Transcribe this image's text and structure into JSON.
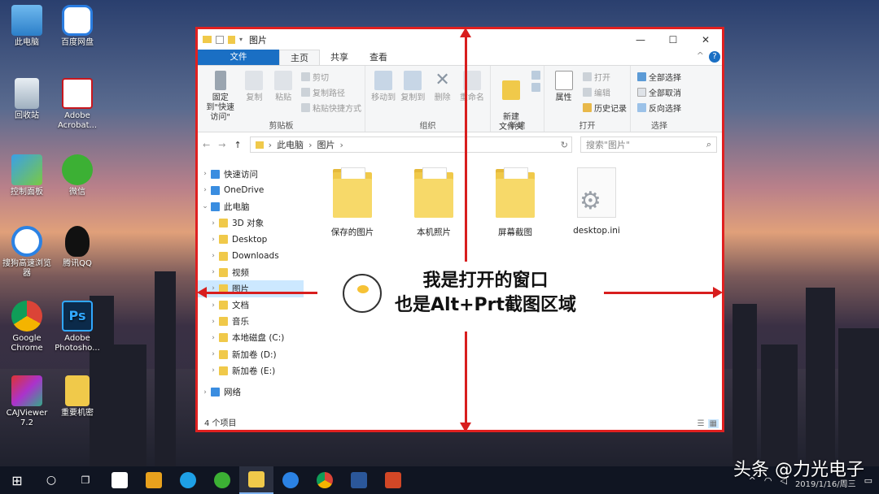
{
  "desktop": {
    "icons": [
      {
        "label": "此电脑",
        "icon": "computer-icon"
      },
      {
        "label": "百度网盘",
        "icon": "baidu-netdisk-icon"
      },
      {
        "label": "回收站",
        "icon": "recycle-bin-icon"
      },
      {
        "label": "Adobe Acrobat...",
        "icon": "acrobat-icon"
      },
      {
        "label": "控制面板",
        "icon": "control-panel-icon"
      },
      {
        "label": "微信",
        "icon": "wechat-icon"
      },
      {
        "label": "搜狗高速浏览器",
        "icon": "sogou-browser-icon"
      },
      {
        "label": "腾讯QQ",
        "icon": "qq-icon"
      },
      {
        "label": "Google Chrome",
        "icon": "chrome-icon"
      },
      {
        "label": "Adobe Photosho...",
        "icon": "photoshop-icon"
      },
      {
        "label": "CAJViewer 7.2",
        "icon": "cajviewer-icon"
      },
      {
        "label": "重要机密",
        "icon": "folder-icon"
      }
    ]
  },
  "window": {
    "title": "图片",
    "controls": {
      "minimize": "—",
      "maximize": "☐",
      "close": "✕"
    },
    "tabs": [
      {
        "label": "文件"
      },
      {
        "label": "主页"
      },
      {
        "label": "共享"
      },
      {
        "label": "查看"
      }
    ],
    "help": "?",
    "collapse": "^",
    "ribbon": {
      "clipboard": {
        "name": "剪贴板",
        "pin": "固定到\"快速访问\"",
        "copy": "复制",
        "paste": "粘贴",
        "cut": "剪切",
        "copy_path": "复制路径",
        "paste_shortcut": "粘贴快捷方式"
      },
      "organize": {
        "name": "组织",
        "move_to": "移动到",
        "copy_to": "复制到",
        "delete": "删除",
        "rename": "重命名"
      },
      "new": {
        "name": "新建",
        "new_folder": "新建\n文件夹"
      },
      "open": {
        "name": "打开",
        "properties": "属性",
        "open": "打开",
        "edit": "编辑",
        "history": "历史记录"
      },
      "select": {
        "name": "选择",
        "select_all": "全部选择",
        "select_none": "全部取消",
        "invert": "反向选择"
      }
    },
    "address": {
      "crumbs": [
        "此电脑",
        "图片"
      ],
      "search_placeholder": "搜索\"图片\""
    },
    "nav": [
      {
        "label": "快速访问",
        "level": 0,
        "chev": ">"
      },
      {
        "label": "OneDrive",
        "level": 0,
        "chev": ">"
      },
      {
        "label": "此电脑",
        "level": 0,
        "chev": "v"
      },
      {
        "label": "3D 对象",
        "level": 1,
        "chev": ">"
      },
      {
        "label": "Desktop",
        "level": 1,
        "chev": ">"
      },
      {
        "label": "Downloads",
        "level": 1,
        "chev": ">"
      },
      {
        "label": "视频",
        "level": 1,
        "chev": ">"
      },
      {
        "label": "图片",
        "level": 1,
        "chev": ">",
        "selected": true
      },
      {
        "label": "文档",
        "level": 1,
        "chev": ">"
      },
      {
        "label": "音乐",
        "level": 1,
        "chev": ">"
      },
      {
        "label": "本地磁盘 (C:)",
        "level": 1,
        "chev": ">"
      },
      {
        "label": "新加卷 (D:)",
        "level": 1,
        "chev": ">"
      },
      {
        "label": "新加卷 (E:)",
        "level": 1,
        "chev": ">"
      },
      {
        "label": "网络",
        "level": 0,
        "chev": ">"
      }
    ],
    "files": [
      {
        "label": "保存的图片",
        "type": "folder"
      },
      {
        "label": "本机照片",
        "type": "folder"
      },
      {
        "label": "屏幕截图",
        "type": "folder"
      },
      {
        "label": "desktop.ini",
        "type": "ini"
      }
    ],
    "status": "4 个项目"
  },
  "annotation": {
    "line1": "我是打开的窗口",
    "line2": "也是Alt+Prt截图区域"
  },
  "taskbar": {
    "clock_date": "2019/1/16/周三",
    "watermark": "头条 @力光电子"
  }
}
